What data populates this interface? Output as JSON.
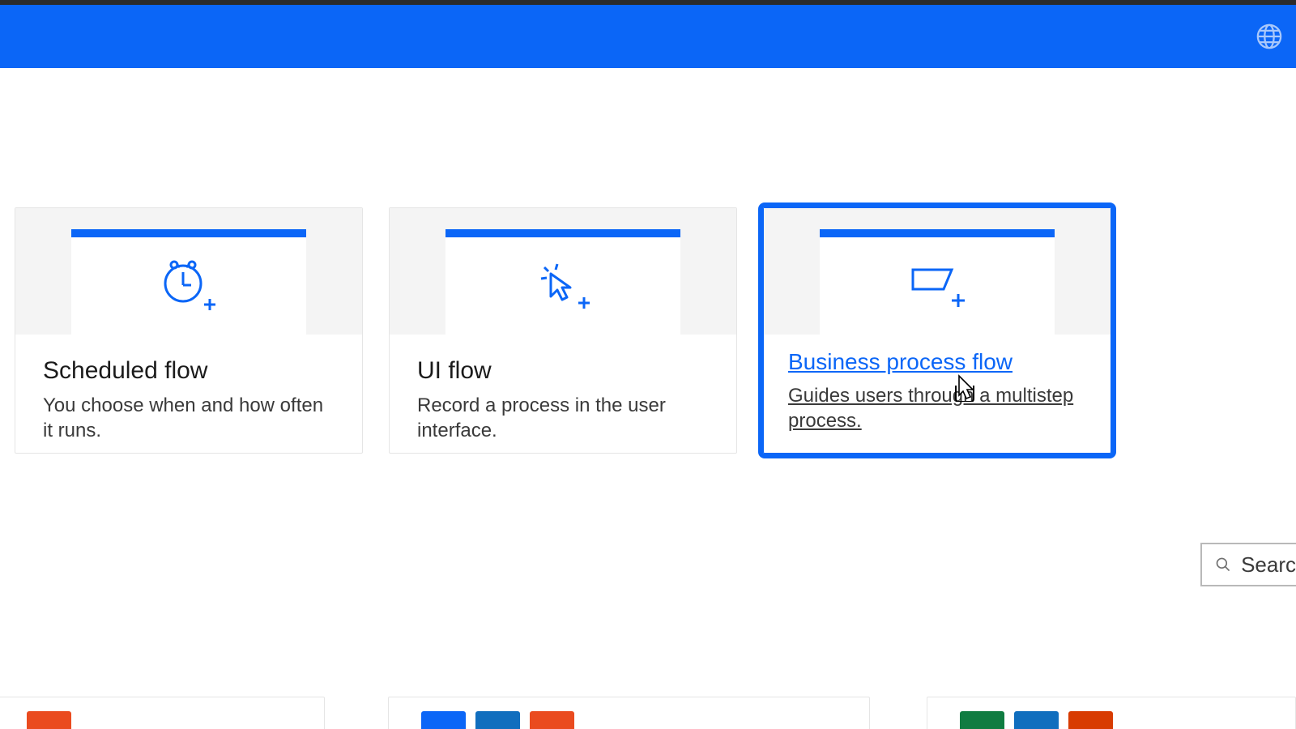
{
  "header": {
    "globe_icon": "globe-icon"
  },
  "cards": [
    {
      "title": "Scheduled flow",
      "desc": "You choose when and how often it runs.",
      "icon": "clock-plus-icon",
      "selected": false
    },
    {
      "title": "UI flow",
      "desc": "Record a process in the user interface.",
      "icon": "cursor-click-plus-icon",
      "selected": false
    },
    {
      "title": "Business process flow",
      "desc": "Guides users through a multistep process.",
      "icon": "parallelogram-plus-icon",
      "selected": true
    }
  ],
  "search": {
    "placeholder": "Searc"
  },
  "bottom_tiles": {
    "group1": [
      "#ea4b1f"
    ],
    "group2": [
      "#0b66f7",
      "#106ebe",
      "#ea4b1f"
    ],
    "group3": [
      "#107c41",
      "#106ebe",
      "#d83b01"
    ]
  }
}
